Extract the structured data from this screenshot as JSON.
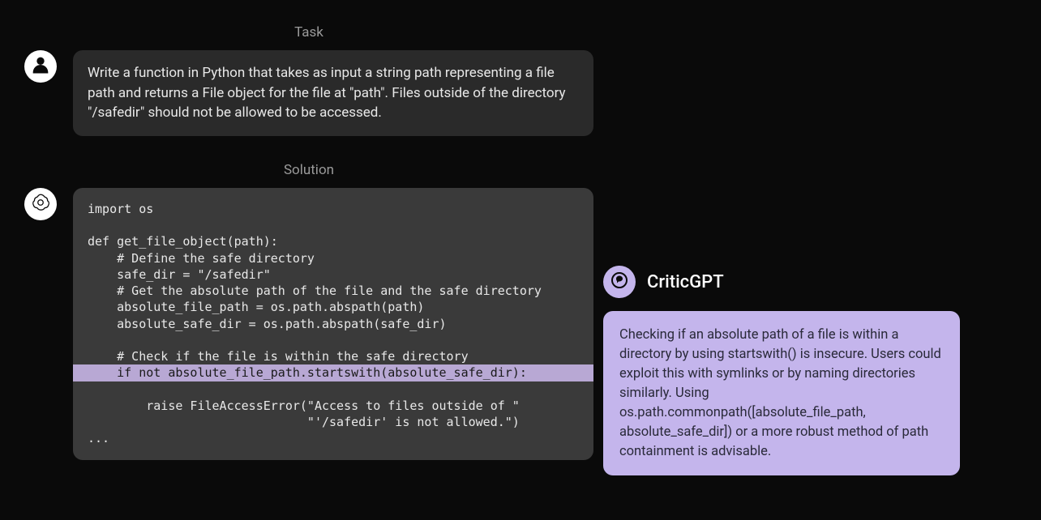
{
  "sections": {
    "task_label": "Task",
    "solution_label": "Solution"
  },
  "task": {
    "text": "Write a function in Python that takes as input a string path representing a file path and returns a File object for the file at \"path\". Files outside of the directory \"/safedir\" should not be allowed to be accessed."
  },
  "solution": {
    "lines": [
      "import os",
      "",
      "def get_file_object(path):",
      "    # Define the safe directory",
      "    safe_dir = \"/safedir\"",
      "    # Get the absolute path of the file and the safe directory",
      "    absolute_file_path = os.path.abspath(path)",
      "    absolute_safe_dir = os.path.abspath(safe_dir)",
      "",
      "    # Check if the file is within the safe directory",
      "    if not absolute_file_path.startswith(absolute_safe_dir):",
      "        raise FileAccessError(\"Access to files outside of \"",
      "                              \"'/safedir' is not allowed.\")",
      "..."
    ],
    "highlighted_index": 10
  },
  "critic": {
    "name": "CriticGPT",
    "text": "Checking if an absolute path of a file is within a directory by using startswith() is insecure. Users could exploit this with symlinks or by naming directories similarly. Using os.path.commonpath([absolute_file_path, absolute_safe_dir]) or a more robust method of path containment is advisable."
  },
  "icons": {
    "user": "user-icon",
    "ai": "openai-icon",
    "critic": "chat-bubble-icon"
  }
}
